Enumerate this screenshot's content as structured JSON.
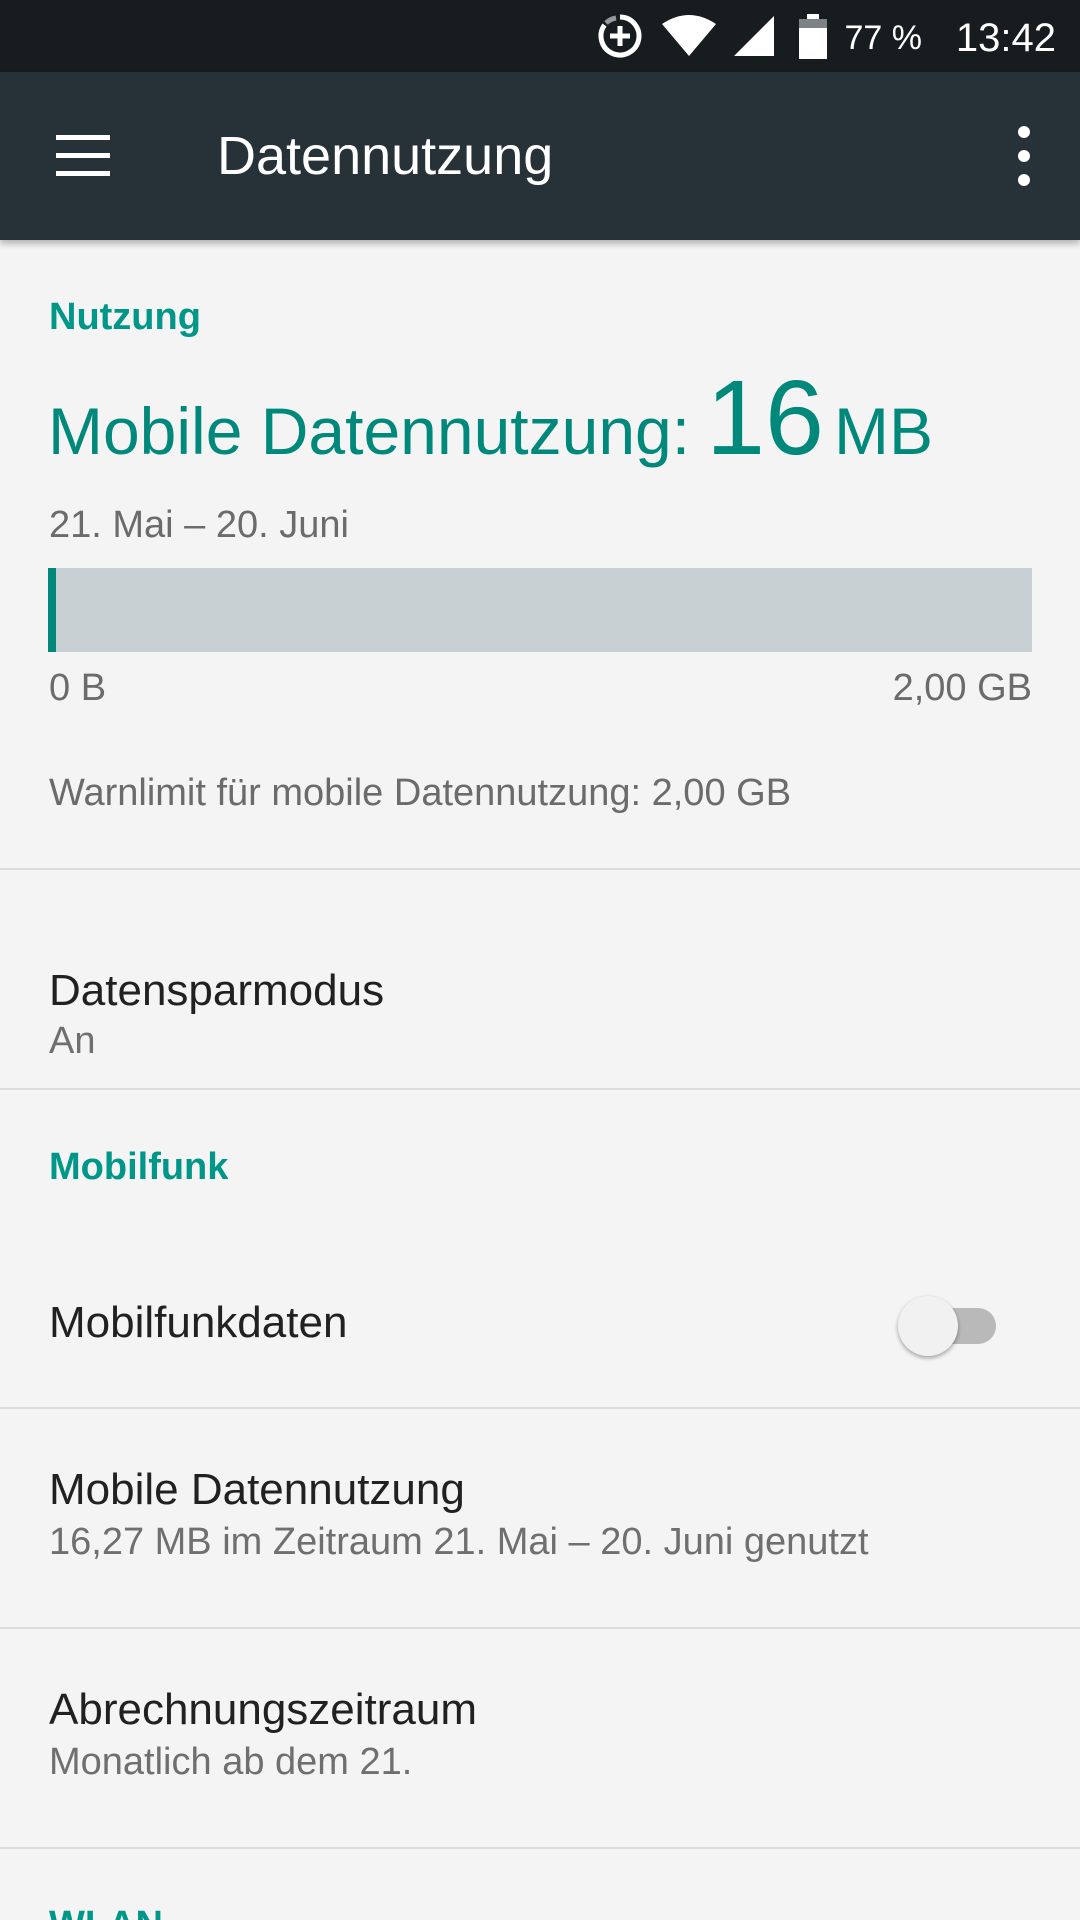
{
  "status_bar": {
    "battery_percent": "77 %",
    "time": "13:42",
    "icons": [
      "data-saver-icon",
      "wifi-icon",
      "cell-signal-icon",
      "battery-icon"
    ]
  },
  "app_bar": {
    "title": "Datennutzung",
    "menu_icon": "hamburger-menu-icon",
    "overflow_icon": "more-vert-icon"
  },
  "usage": {
    "section_title": "Nutzung",
    "headline_label": "Mobile Datennutzung:",
    "headline_value": "16",
    "headline_unit": "MB",
    "period": "21. Mai – 20. Juni",
    "bar_min_label": "0 B",
    "bar_max_label": "2,00 GB",
    "bar_fill_fraction": 0.008,
    "warning_text": "Warnlimit für mobile Datennutzung: 2,00 GB"
  },
  "data_saver": {
    "title": "Datensparmodus",
    "summary": "An"
  },
  "mobile": {
    "section_title": "Mobilfunk",
    "mobile_data_title": "Mobilfunkdaten",
    "mobile_data_enabled": false,
    "usage_title": "Mobile Datennutzung",
    "usage_summary": "16,27 MB im Zeitraum 21. Mai – 20. Juni genutzt",
    "billing_title": "Abrechnungszeitraum",
    "billing_summary": "Monatlich ab dem 21."
  },
  "wlan": {
    "section_title": "WLAN"
  },
  "colors": {
    "accent": "#009688",
    "app_bar": "#263238",
    "status_bar": "#171c1f",
    "background": "#f4f4f4"
  }
}
